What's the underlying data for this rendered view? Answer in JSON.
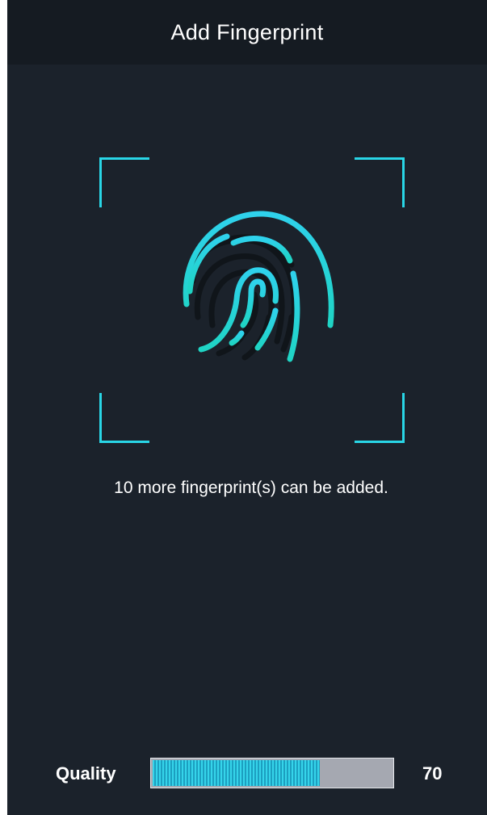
{
  "header": {
    "title": "Add Fingerprint"
  },
  "scanner": {
    "icon": "fingerprint-icon",
    "frame_color": "#29d6e6",
    "message": "10 more fingerprint(s) can be added."
  },
  "quality": {
    "label": "Quality",
    "value": "70",
    "fill_fraction": 0.7,
    "fill_color": "#25c7df",
    "track_color": "#a5a8b1"
  },
  "colors": {
    "background": "#1b222b",
    "header_background": "#151b22",
    "accent": "#29d6e6"
  }
}
